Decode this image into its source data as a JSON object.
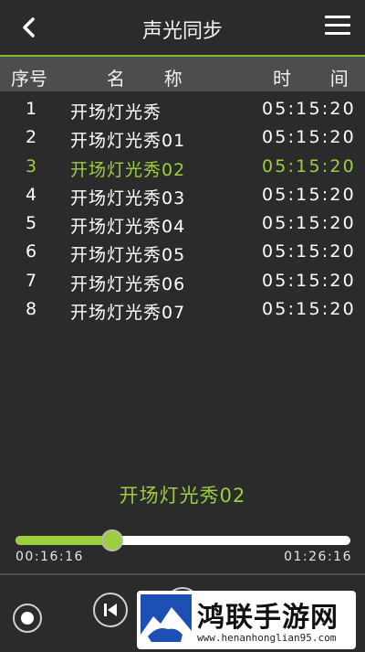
{
  "header": {
    "title": "声光同步",
    "back_icon": "chevron-left-icon",
    "menu_icon": "hamburger-menu-icon"
  },
  "columns": {
    "no": "序号",
    "name": "名  称",
    "time": "时  间"
  },
  "songs": [
    {
      "no": "1",
      "name": "开场灯光秀",
      "time": "05:15:20"
    },
    {
      "no": "2",
      "name": "开场灯光秀01",
      "time": "05:15:20"
    },
    {
      "no": "3",
      "name": "开场灯光秀02",
      "time": "05:15:20"
    },
    {
      "no": "4",
      "name": "开场灯光秀03",
      "time": "05:15:20"
    },
    {
      "no": "5",
      "name": "开场灯光秀04",
      "time": "05:15:20"
    },
    {
      "no": "6",
      "name": "开场灯光秀05",
      "time": "05:15:20"
    },
    {
      "no": "7",
      "name": "开场灯光秀06",
      "time": "05:15:20"
    },
    {
      "no": "8",
      "name": "开场灯光秀07",
      "time": "05:15:20"
    }
  ],
  "active_index": 2,
  "now_playing": "开场灯光秀02",
  "progress": {
    "current": "00:16:16",
    "total": "01:26:16",
    "fraction": 0.29
  },
  "colors": {
    "accent": "#9ccf3f",
    "background": "#2b2b2b",
    "header_row": "#4d4d4d"
  },
  "watermark": {
    "title": "鸿联手游网",
    "url": "www.henanhonglian95.com"
  }
}
